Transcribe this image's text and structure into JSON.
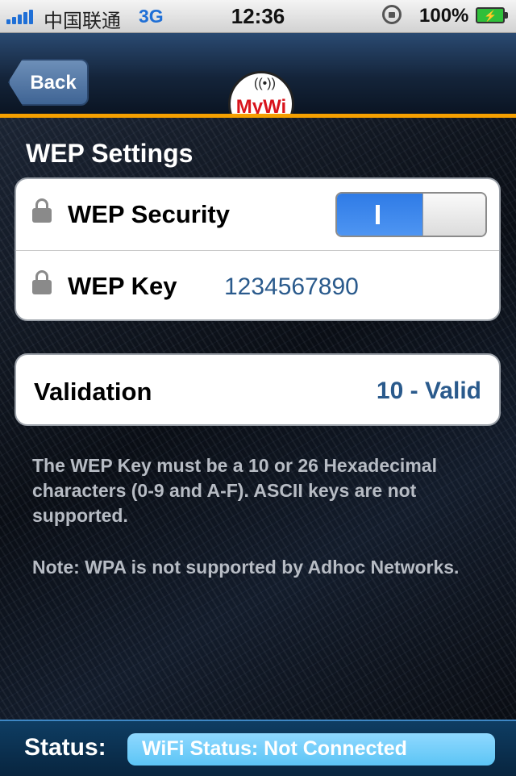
{
  "status_bar": {
    "carrier": "中国联通",
    "network": "3G",
    "time": "12:36",
    "battery": "100%"
  },
  "nav": {
    "back_label": "Back",
    "logo_text": "MyWi"
  },
  "settings": {
    "section_title": "WEP Settings",
    "wep_security_label": "WEP Security",
    "wep_security_on": true,
    "wep_key_label": "WEP Key",
    "wep_key_value": "1234567890"
  },
  "validation": {
    "label": "Validation",
    "value": "10 - Valid"
  },
  "help": {
    "paragraph1": "The WEP Key must be a 10 or 26 Hexadecimal characters (0-9 and A-F). ASCII keys are not supported.",
    "paragraph2": "Note: WPA is not supported by Adhoc Networks."
  },
  "footer": {
    "status_label": "Status:",
    "status_value": "WiFi Status: Not Connected"
  },
  "colors": {
    "accent_orange": "#f5a000",
    "value_blue": "#2a5a8c",
    "toggle_blue": "#2f7be6"
  }
}
